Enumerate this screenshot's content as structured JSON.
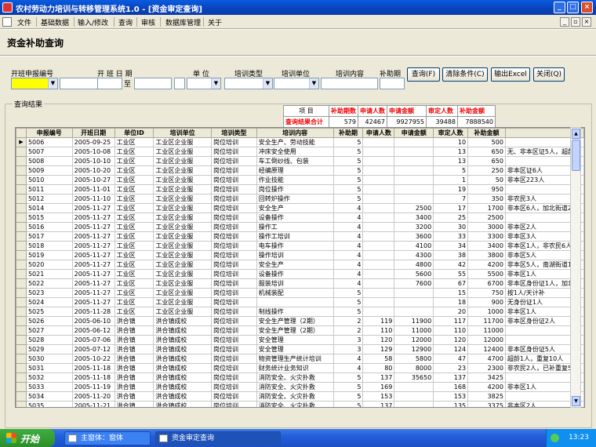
{
  "window": {
    "title": "农村劳动力培训与转移管理系统1.0 - [资金审定查询]",
    "minimize": "_",
    "maximize": "□",
    "close": "×"
  },
  "menu": {
    "items": [
      "文件",
      "基础数据",
      "输入/修改",
      "查询",
      "审核",
      "数据库管理",
      "关于"
    ],
    "mdi_minimize": "_",
    "mdi_restore": "▫",
    "mdi_close": "×"
  },
  "page": {
    "title": "资金补助查询"
  },
  "filters": {
    "labels": {
      "apply_no": "开班申报编号",
      "start_date": "开  班  日  期",
      "unit": "单  位",
      "type": "培训类型",
      "train_unit": "培训单位",
      "content": "培训内容",
      "period": "补助期"
    },
    "to_label": "至",
    "dropdown_arrow": "▼"
  },
  "buttons": {
    "query": "查询(F)",
    "clear": "清除条件(C)",
    "export": "输出Excel",
    "close": "关闭(Q)"
  },
  "results": {
    "group_label": "查询结果",
    "summary": {
      "headers": [
        "项    目",
        "补助期数",
        "申请人数",
        "申请金额",
        "审定人数",
        "补助金额"
      ],
      "total_label": "查询结果合计",
      "totals": [
        "579",
        "42467",
        "9927955",
        "39488",
        "7888540"
      ]
    },
    "columns": [
      "申报编号",
      "开班日期",
      "单位ID",
      "培训单位",
      "培训类型",
      "培训内容",
      "补助期",
      "申请人数",
      "申请金额",
      "审定人数",
      "补助金额",
      ""
    ],
    "current_row_marker": "▶",
    "rows": [
      [
        "5006",
        "2005-09-25",
        "工业区",
        "工业区企业服",
        "岗位培训",
        "安全生产、劳动技能",
        "5",
        "",
        "",
        "10",
        "500",
        ""
      ],
      [
        "5007",
        "2005-10-08",
        "工业区",
        "工业区企业服",
        "岗位培训",
        "冲床安全使用",
        "5",
        "",
        "",
        "13",
        "650",
        "无、非本区证5人，超龄2"
      ],
      [
        "5008",
        "2005-10-10",
        "工业区",
        "工业区企业服",
        "岗位培训",
        "车工倒纱线、包装",
        "5",
        "",
        "",
        "13",
        "650",
        ""
      ],
      [
        "5009",
        "2005-10-20",
        "工业区",
        "工业区企业服",
        "岗位培训",
        "经编原理",
        "5",
        "",
        "",
        "5",
        "250",
        "非本区证6人"
      ],
      [
        "5010",
        "2005-10-27",
        "工业区",
        "工业区企业服",
        "岗位培训",
        "作业技能",
        "5",
        "",
        "",
        "1",
        "50",
        "非本区223人"
      ],
      [
        "5011",
        "2005-11-01",
        "工业区",
        "工业区企业服",
        "岗位培训",
        "岗位操作",
        "5",
        "",
        "",
        "19",
        "950",
        ""
      ],
      [
        "5012",
        "2005-11-10",
        "工业区",
        "工业区企业服",
        "岗位培训",
        "回转炉操作",
        "5",
        "",
        "",
        "7",
        "350",
        "非农民3人"
      ],
      [
        "5014",
        "2005-11-27",
        "工业区",
        "工业区企业服",
        "岗位培训",
        "安全生产",
        "4",
        "",
        "2500",
        "17",
        "1700",
        "非本区6人，加北街道2人"
      ],
      [
        "5015",
        "2005-11-27",
        "工业区",
        "工业区企业服",
        "岗位培训",
        "设备操作",
        "4",
        "",
        "3400",
        "25",
        "2500",
        ""
      ],
      [
        "5016",
        "2005-11-27",
        "工业区",
        "工业区企业服",
        "岗位培训",
        "操作工",
        "4",
        "",
        "3200",
        "30",
        "3000",
        "非本区2人"
      ],
      [
        "5017",
        "2005-11-27",
        "工业区",
        "工业区企业服",
        "岗位培训",
        "操作工培训",
        "4",
        "",
        "3600",
        "33",
        "3300",
        "非本区3人"
      ],
      [
        "5018",
        "2005-11-27",
        "工业区",
        "工业区企业服",
        "岗位培训",
        "电车操作",
        "4",
        "",
        "4100",
        "34",
        "3400",
        "非本区1人，非农民6人"
      ],
      [
        "5019",
        "2005-11-27",
        "工业区",
        "工业区企业服",
        "岗位培训",
        "操作培训",
        "4",
        "",
        "4300",
        "38",
        "3800",
        "非本区5人"
      ],
      [
        "5020",
        "2005-11-27",
        "工业区",
        "工业区企业服",
        "岗位培训",
        "安全生产",
        "4",
        "",
        "4800",
        "42",
        "4200",
        "非本区5人，南湖街道1人"
      ],
      [
        "5021",
        "2005-11-27",
        "工业区",
        "工业区企业服",
        "岗位培训",
        "设备操作",
        "4",
        "",
        "5600",
        "55",
        "5500",
        "非本区1人"
      ],
      [
        "5022",
        "2005-11-27",
        "工业区",
        "工业区企业服",
        "岗位培训",
        "服装培训",
        "4",
        "",
        "7600",
        "67",
        "6700",
        "非本区身份证1人，加北街"
      ],
      [
        "5023",
        "2005-11-27",
        "工业区",
        "工业区企业服",
        "岗位培训",
        "机械装配",
        "5",
        "",
        "",
        "15",
        "750",
        "按1人/天计补"
      ],
      [
        "5024",
        "2005-11-27",
        "工业区",
        "工业区企业服",
        "岗位培训",
        "",
        "5",
        "",
        "",
        "18",
        "900",
        "无身份证1人"
      ],
      [
        "5025",
        "2005-11-28",
        "工业区",
        "工业区企业服",
        "岗位培训",
        "制线操作",
        "5",
        "",
        "",
        "20",
        "1000",
        "非本区1人"
      ],
      [
        "5026",
        "2005-06-10",
        "洪合镇",
        "洪合镇成校",
        "岗位培训",
        "安全生产管理（2期）",
        "2",
        "119",
        "11900",
        "117",
        "11700",
        "非本区身份证2人"
      ],
      [
        "5027",
        "2005-06-12",
        "洪合镇",
        "洪合镇成校",
        "岗位培训",
        "安全生产管理（2期）",
        "2",
        "110",
        "11000",
        "110",
        "11000",
        ""
      ],
      [
        "5028",
        "2005-07-06",
        "洪合镇",
        "洪合镇成校",
        "岗位培训",
        "安全管理",
        "3",
        "120",
        "12000",
        "120",
        "12000",
        ""
      ],
      [
        "5029",
        "2005-07-12",
        "洪合镇",
        "洪合镇成校",
        "岗位培训",
        "安全管理",
        "3",
        "129",
        "12900",
        "124",
        "12400",
        "非本区身份证5人"
      ],
      [
        "5030",
        "2005-10-22",
        "洪合镇",
        "洪合镇成校",
        "岗位培训",
        "物资管理生产统计培训",
        "4",
        "58",
        "5800",
        "47",
        "4700",
        "超龄1人，重复10人"
      ],
      [
        "5031",
        "2005-11-18",
        "洪合镇",
        "洪合镇成校",
        "岗位培训",
        "财务统计业务知识",
        "4",
        "80",
        "8000",
        "23",
        "2300",
        "非农民2人，已补重复55"
      ],
      [
        "5032",
        "2005-11-18",
        "洪合镇",
        "洪合镇成校",
        "岗位培训",
        "消防安全、火灾扑救",
        "5",
        "137",
        "35650",
        "137",
        "3425",
        ""
      ],
      [
        "5033",
        "2005-11-19",
        "洪合镇",
        "洪合镇成校",
        "岗位培训",
        "消防安全、火灾扑救",
        "5",
        "169",
        "",
        "168",
        "4200",
        "非本区1人"
      ],
      [
        "5034",
        "2005-11-20",
        "洪合镇",
        "洪合镇成校",
        "岗位培训",
        "消防安全、火灾扑救",
        "5",
        "153",
        "",
        "153",
        "3825",
        ""
      ],
      [
        "5035",
        "2005-11-21",
        "洪合镇",
        "洪合镇成校",
        "岗位培训",
        "消防安全、火灾扑救",
        "5",
        "137",
        "",
        "135",
        "3375",
        "非本区2人"
      ]
    ]
  },
  "taskbar": {
    "start": "开始",
    "tasks": [
      "主窗体：窗体",
      "资金审定查询"
    ],
    "clock": "13:23"
  },
  "colors": {
    "title_bar": "#0846c0",
    "window_bg": "#ece9d8",
    "highlight_field": "#ffff00",
    "summary_header": "#e00000"
  }
}
